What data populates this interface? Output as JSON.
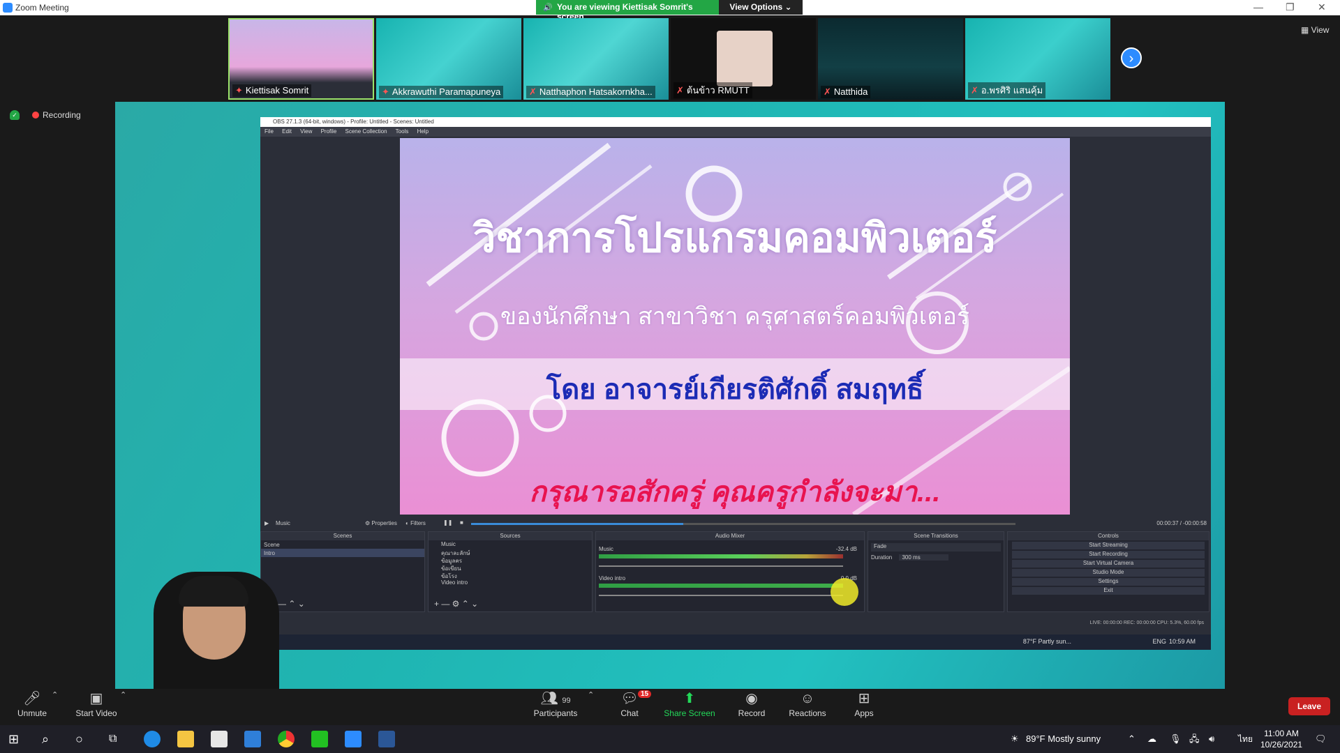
{
  "window": {
    "title": "Zoom Meeting",
    "banner": "You are viewing Kiettisak Somrit's screen",
    "view_options": "View Options",
    "view_label": "View"
  },
  "participants": [
    {
      "name": "Kiettisak Somrit"
    },
    {
      "name": "Akkrawuthi Paramapuneya"
    },
    {
      "name": "Natthaphon Hatsakornkha..."
    },
    {
      "name": "ต้นข้าว RMUTT"
    },
    {
      "name": "Natthida"
    },
    {
      "name": "อ.พรศิริ แสนคุ้ม"
    }
  ],
  "recording": {
    "label": "Recording"
  },
  "obs": {
    "title": "OBS 27.1.3 (64-bit, windows) - Profile: Untitled - Scenes: Untitled",
    "menu": [
      "File",
      "Edit",
      "View",
      "Profile",
      "Scene Collection",
      "Tools",
      "Help"
    ],
    "transport": {
      "source": "Music",
      "properties": "Properties",
      "filters": "Filters",
      "time": "00:00:37 / -00:00:58"
    },
    "panels": {
      "scenes": {
        "title": "Scenes",
        "items": [
          "Scene",
          "Intro"
        ]
      },
      "sources": {
        "title": "Sources",
        "items": [
          "Music",
          "คุณาละลักษ์",
          "ข้อมูลคร",
          "ข้อเขียน",
          "ข้อโรง",
          "Video intro"
        ]
      },
      "audio": {
        "title": "Audio Mixer",
        "tracks": [
          {
            "name": "Music",
            "db": "-32.4 dB"
          },
          {
            "name": "Video intro",
            "db": "0.0 dB"
          }
        ]
      },
      "transitions": {
        "title": "Scene Transitions",
        "type": "Fade",
        "duration_label": "Duration",
        "duration": "300 ms"
      },
      "controls": {
        "title": "Controls",
        "buttons": [
          "Start Streaming",
          "Start Recording",
          "Start Virtual Camera",
          "Studio Mode",
          "Settings",
          "Exit"
        ]
      }
    },
    "status": "LIVE: 00:00:00   REC: 00:00:00   CPU: 5.3%, 60.00 fps",
    "inner_taskbar": {
      "weather": "87°F  Partly sun...",
      "lang": "ENG",
      "time": "10:59 AM"
    }
  },
  "slide": {
    "line1": "วิชาการโปรแกรมคอมพิวเตอร์",
    "line2": "ของนักศึกษา สาขาวิชา ครุศาสตร์คอมพิวเตอร์",
    "line3": "โดย อาจารย์เกียรติศักดิ์ สมฤทธิ์",
    "line4": "กรุณารอสักครู่ คุณครูกำลังจะมา..."
  },
  "toolbar": {
    "unmute": "Unmute",
    "start_video": "Start Video",
    "participants": "Participants",
    "participants_count": "99",
    "chat": "Chat",
    "chat_badge": "15",
    "share_screen": "Share Screen",
    "record": "Record",
    "reactions": "Reactions",
    "apps": "Apps",
    "leave": "Leave"
  },
  "taskbar": {
    "weather": "89°F  Mostly sunny",
    "lang": "ไทย",
    "time": "11:00 AM",
    "date": "10/26/2021"
  },
  "colors": {
    "accent": "#2d8cff",
    "green": "#23a645",
    "leave": "#c92121"
  }
}
